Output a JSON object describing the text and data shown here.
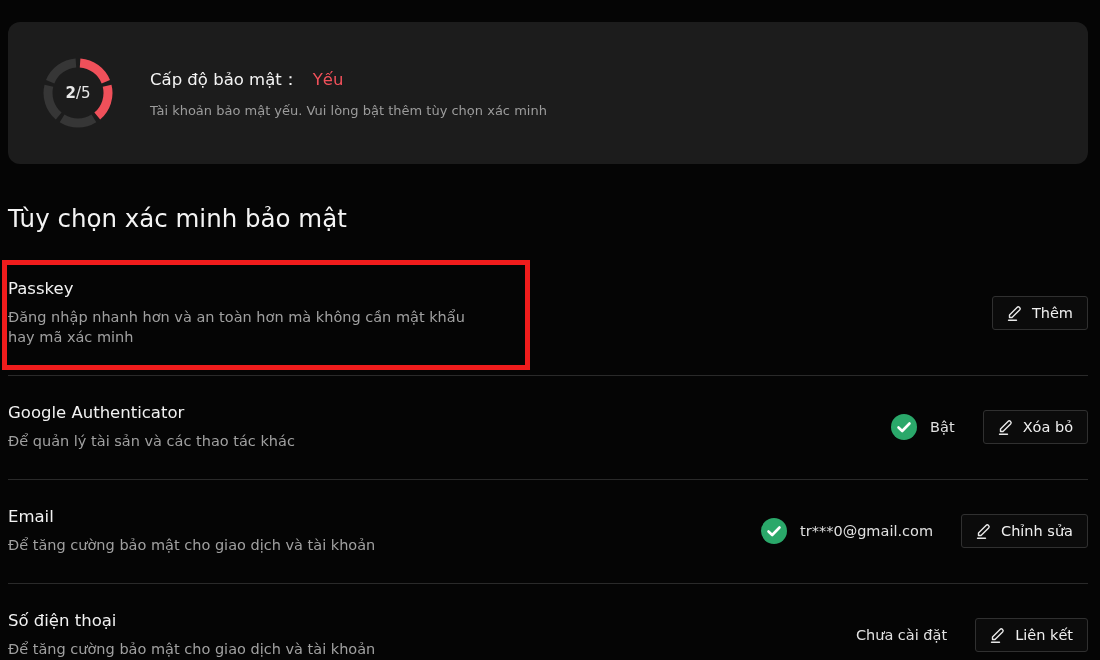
{
  "security_level": {
    "segments": [
      {
        "filled": true
      },
      {
        "filled": true
      },
      {
        "filled": false
      },
      {
        "filled": false
      },
      {
        "filled": false
      }
    ],
    "score": "**2**/5",
    "label": "Cấp độ bảo mật：",
    "rating": {
      "text": "Yếu",
      "kind": "weak"
    },
    "message": "Tài khoản bảo mật yếu. Vui lòng bật thêm tùy chọn xác minh"
  },
  "section_title": "Tùy chọn xác minh bảo mật",
  "options": [
    {
      "title": "Passkey",
      "description": "Đăng nhập nhanh hơn và an toàn hơn mà không cần mật khẩu hay mã xác minh",
      "highlighted": true,
      "button": "Thêm"
    },
    {
      "title": "Google Authenticator",
      "description": "Để quản lý tài sản và các thao tác khác",
      "highlighted": false,
      "status": {
        "text": "Bật",
        "verified": true
      },
      "button": "Xóa bỏ"
    },
    {
      "title": "Email",
      "description": "Để tăng cường bảo mật cho giao dịch và tài khoản",
      "highlighted": false,
      "status": {
        "text": "tr***0@gmail.com",
        "verified": true
      },
      "button": "Chỉnh sửa"
    },
    {
      "title": "Số điện thoại",
      "description": "Để tăng cường bảo mật cho giao dịch và tài khoản",
      "highlighted": false,
      "status": {
        "text": "Chưa cài đặt",
        "verified": false
      },
      "button": "Liên kết"
    }
  ]
}
